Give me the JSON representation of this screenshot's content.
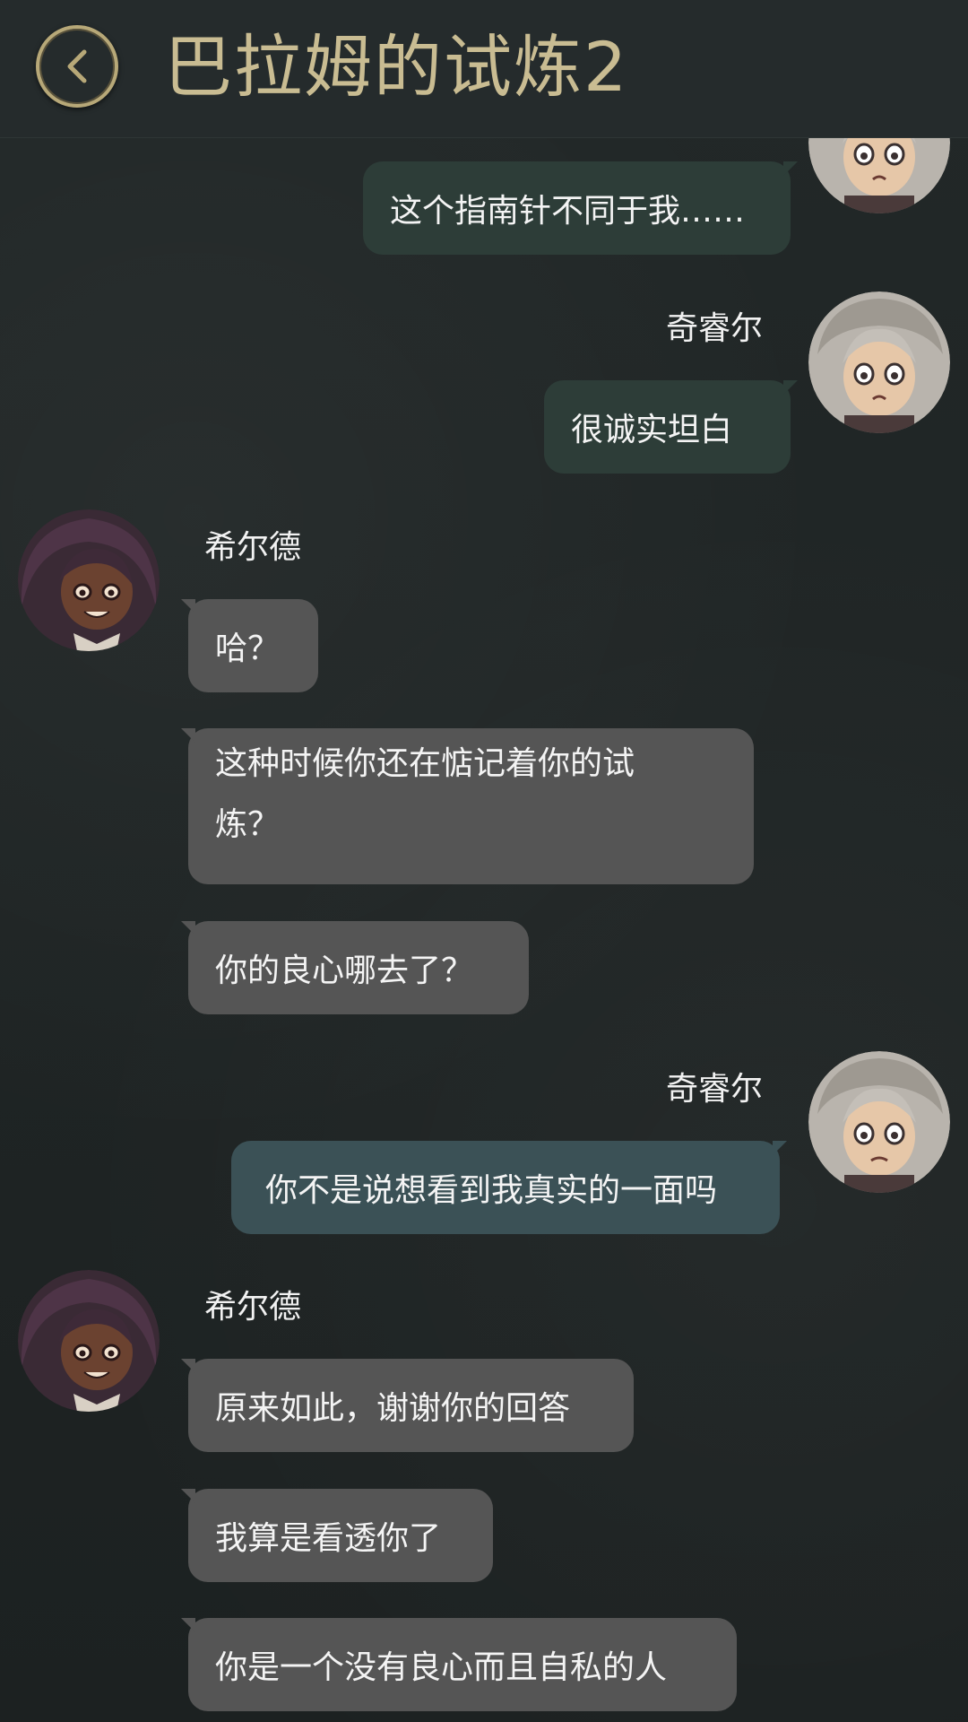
{
  "header": {
    "title": "巴拉姆的试炼2"
  },
  "messages": [
    {
      "speaker": "",
      "side": "right",
      "text": "这个指南针不同于我……"
    },
    {
      "speaker": "奇睿尔",
      "side": "right",
      "text": "很诚实坦白"
    },
    {
      "speaker": "希尔德",
      "side": "left",
      "text": "哈？"
    },
    {
      "speaker": "",
      "side": "left",
      "text": "这种时候你还在惦记着你的试炼？"
    },
    {
      "speaker": "",
      "side": "left",
      "text": "你的良心哪去了？"
    },
    {
      "speaker": "奇睿尔",
      "side": "right",
      "text": "你不是说想看到我真实的一面吗"
    },
    {
      "speaker": "希尔德",
      "side": "left",
      "text": "原来如此，谢谢你的回答"
    },
    {
      "speaker": "",
      "side": "left",
      "text": "我算是看透你了"
    },
    {
      "speaker": "",
      "side": "left",
      "text": "你是一个没有良心而且自私的人"
    }
  ],
  "colors": {
    "header_title": "#c9bc92",
    "back_ring": "#b7a878",
    "my_bubble": "#2d3d38",
    "my_bubble_highlight": "#3b5156",
    "other_bubble": "#555555"
  },
  "icons": {
    "back": "chevron-left-icon",
    "avatar_me": "silver-haired-character-avatar",
    "avatar_other": "dark-haired-character-avatar"
  }
}
